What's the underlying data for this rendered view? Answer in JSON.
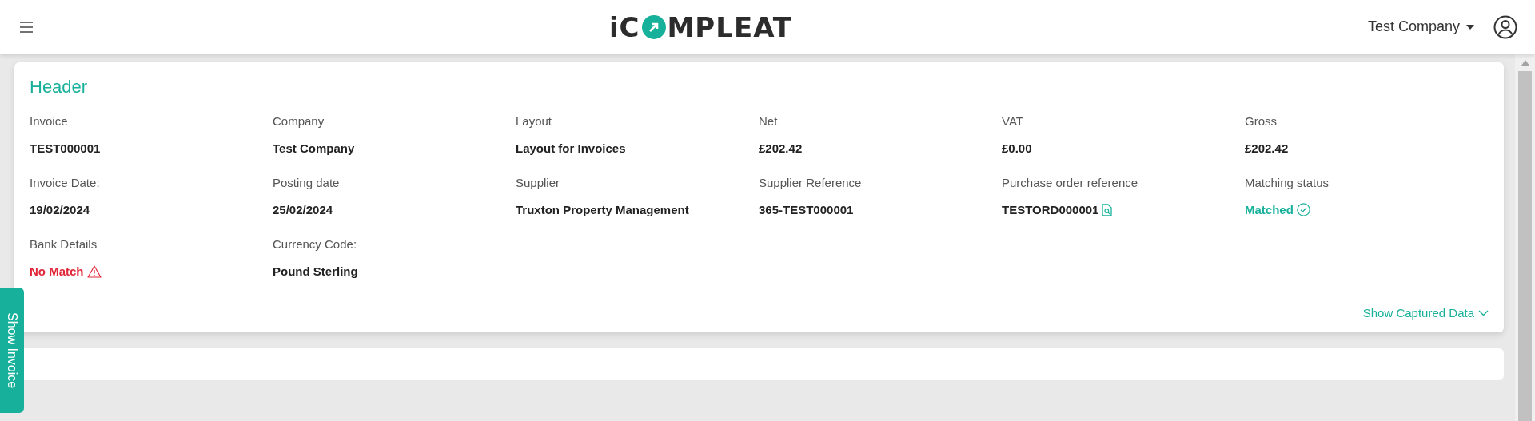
{
  "navbar": {
    "logo": {
      "before": "iC",
      "after": "MPLEAT"
    },
    "company_menu": "Test Company"
  },
  "header": {
    "title": "Header",
    "fields": [
      {
        "label": "Invoice",
        "value": "TEST000001",
        "kind": "text"
      },
      {
        "label": "Company",
        "value": "Test Company",
        "kind": "text"
      },
      {
        "label": "Layout",
        "value": "Layout for Invoices",
        "kind": "text"
      },
      {
        "label": "Net",
        "value": "£202.42",
        "kind": "text"
      },
      {
        "label": "VAT",
        "value": "£0.00",
        "kind": "text"
      },
      {
        "label": "Gross",
        "value": "£202.42",
        "kind": "text"
      },
      {
        "label": "Invoice Date:",
        "value": "19/02/2024",
        "kind": "text"
      },
      {
        "label": "Posting date",
        "value": "25/02/2024",
        "kind": "text"
      },
      {
        "label": "Supplier",
        "value": "Truxton Property Management",
        "kind": "text"
      },
      {
        "label": "Supplier Reference",
        "value": "365-TEST000001",
        "kind": "text"
      },
      {
        "label": "Purchase order reference",
        "value": "TESTORD000001",
        "kind": "document"
      },
      {
        "label": "Matching status",
        "value": "Matched",
        "kind": "success"
      },
      {
        "label": "Bank Details",
        "value": "No Match",
        "kind": "error"
      },
      {
        "label": "Currency Code:",
        "value": "Pound Sterling",
        "kind": "text"
      }
    ],
    "toggle": "Show Captured Data"
  },
  "side_tab": "Show Invoice"
}
